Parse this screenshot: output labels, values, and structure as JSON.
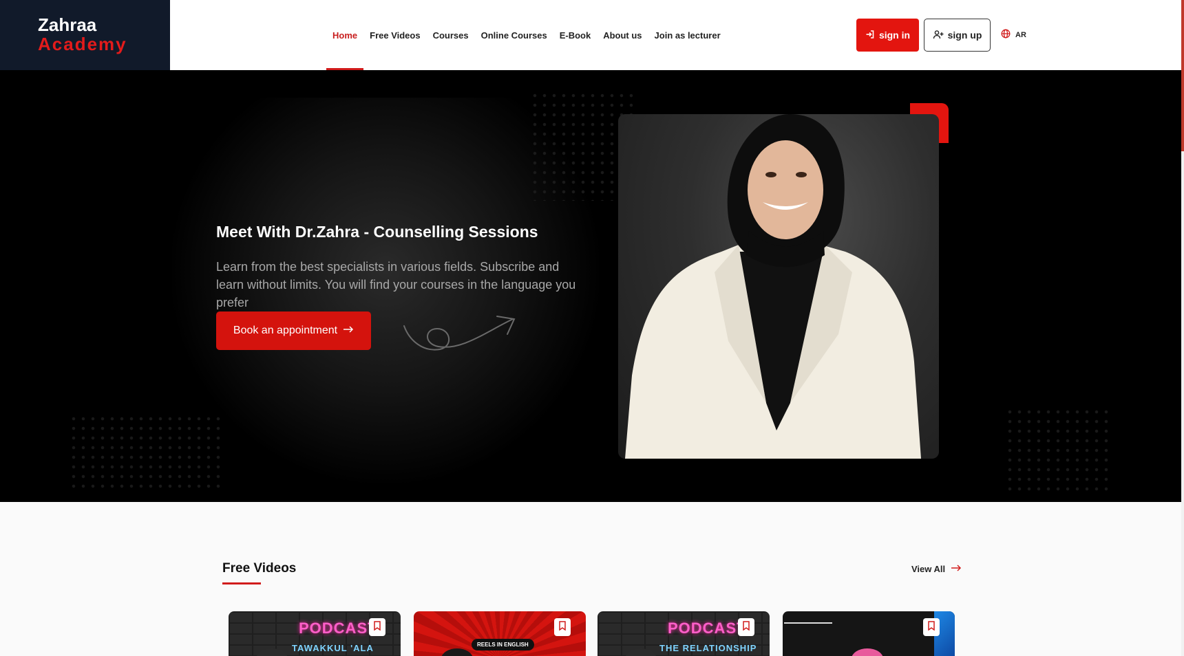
{
  "header": {
    "logo_line1": "Zahraa",
    "logo_line2": "Academy",
    "nav": [
      {
        "label": "Home",
        "active": true
      },
      {
        "label": "Free Videos",
        "active": false
      },
      {
        "label": "Courses",
        "active": false
      },
      {
        "label": "Online Courses",
        "active": false
      },
      {
        "label": "E-Book",
        "active": false
      },
      {
        "label": "About us",
        "active": false
      },
      {
        "label": "Join as lecturer",
        "active": false
      }
    ],
    "signin_label": "sign in",
    "signup_label": "sign up",
    "language_label": "AR"
  },
  "hero": {
    "title": "Meet With Dr.Zahra - Counselling Sessions",
    "description": "Learn from the best specialists in various fields. Subscribe and learn without limits. You will find your courses in the language you prefer",
    "cta_label": "Book an appointment"
  },
  "free_videos": {
    "title": "Free Videos",
    "view_all_label": "View All",
    "cards": [
      {
        "heading": "PODCAST",
        "subheading": "TAWAKKUL 'ALA"
      },
      {
        "heading": "",
        "subheading": "REELS IN ENGLISH"
      },
      {
        "heading": "PODCAST",
        "subheading": "THE RELATIONSHIP"
      },
      {
        "heading": "",
        "subheading": ""
      }
    ]
  },
  "colors": {
    "accent": "#e3150f",
    "logo_background": "#111a2a",
    "hero_background": "#000000"
  },
  "icons": [
    "sign-in-icon",
    "user-plus-icon",
    "globe-icon",
    "arrow-right-icon",
    "bookmark-icon"
  ]
}
